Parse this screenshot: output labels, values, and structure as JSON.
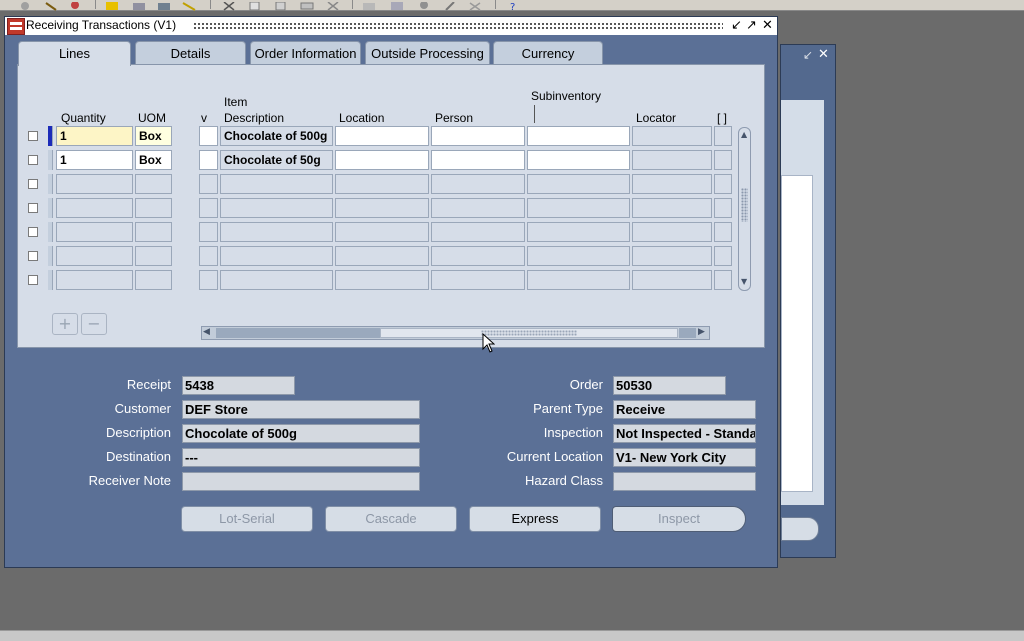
{
  "window": {
    "title": "Receiving Transactions (V1)",
    "controls": {
      "minimize": "↙",
      "maximize": "↗",
      "close": "✕"
    }
  },
  "bg_window": {
    "controls": {
      "minimize": "↙",
      "close": "✕"
    }
  },
  "tabs": [
    {
      "label": "Lines",
      "active": true
    },
    {
      "label": "Details",
      "active": false
    },
    {
      "label": "Order Information",
      "active": false
    },
    {
      "label": "Outside Processing",
      "active": false
    },
    {
      "label": "Currency",
      "active": false
    }
  ],
  "grid": {
    "headers": {
      "quantity": "Quantity",
      "uom": "UOM",
      "v": "v",
      "item": "Item",
      "description": "Description",
      "location": "Location",
      "person": "Person",
      "subinventory": "Subinventory",
      "locator": "Locator",
      "more": "[ ]"
    },
    "rows": [
      {
        "quantity": "1",
        "uom": "Box",
        "description": "Chocolate of 500g"
      },
      {
        "quantity": "1",
        "uom": "Box",
        "description": "Chocolate of 50g"
      }
    ]
  },
  "form": {
    "receipt": {
      "label": "Receipt",
      "value": "5438"
    },
    "customer": {
      "label": "Customer",
      "value": "DEF Store"
    },
    "description": {
      "label": "Description",
      "value": "Chocolate of 500g"
    },
    "destination": {
      "label": "Destination",
      "value": "---"
    },
    "receiver_note": {
      "label": "Receiver Note",
      "value": ""
    },
    "order": {
      "label": "Order",
      "value": "50530"
    },
    "parent_type": {
      "label": "Parent Type",
      "value": "Receive"
    },
    "inspection": {
      "label": "Inspection",
      "value": "Not Inspected - Standa"
    },
    "current_location": {
      "label": "Current Location",
      "value": "V1- New York City"
    },
    "hazard_class": {
      "label": "Hazard Class",
      "value": ""
    }
  },
  "buttons": {
    "lot_serial": "Lot-Serial",
    "cascade": "Cascade",
    "express": "Express",
    "inspect": "Inspect"
  },
  "colors": {
    "window_bg": "#5b7096",
    "panel_bg": "#d6dde8",
    "current_row": "#1c2bb8"
  }
}
